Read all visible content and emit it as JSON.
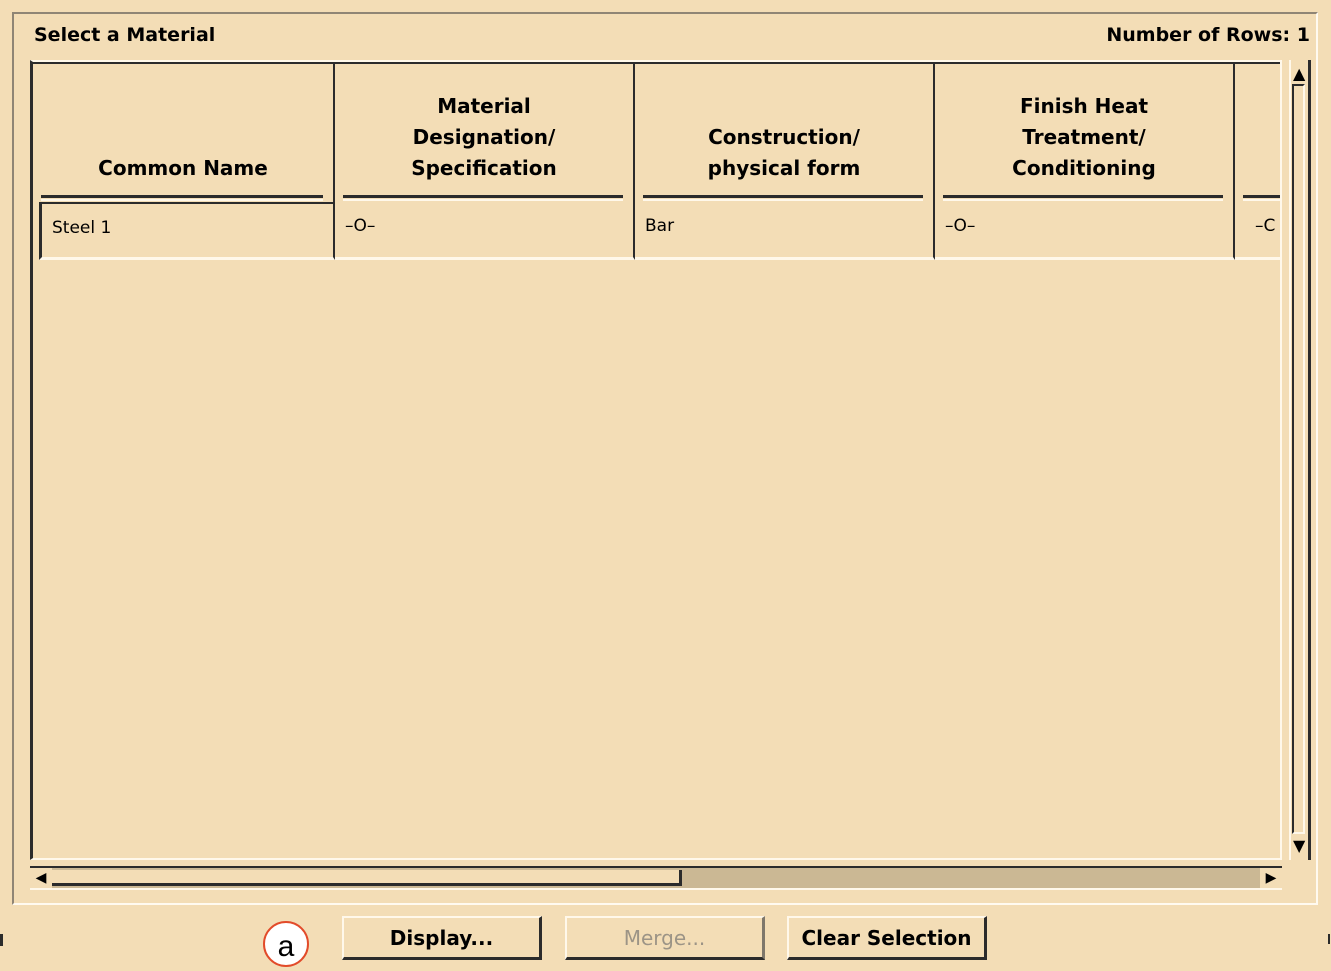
{
  "title": "Select a Material",
  "rows_label": "Number of Rows:",
  "rows_count": "1",
  "table": {
    "headers": [
      "Common Name",
      "Material\nDesignation/\nSpecification",
      "Construction/\nphysical form",
      "Finish Heat\nTreatment/\nConditioning",
      ""
    ],
    "rows": [
      [
        "Steel 1",
        "–O–",
        "Bar",
        "–O–",
        "–C"
      ]
    ]
  },
  "buttons": {
    "display": "Display...",
    "merge": "Merge...",
    "clear": "Clear Selection"
  },
  "callout": "a",
  "icons": {
    "scroll_up": "up-arrow-icon",
    "scroll_down": "down-arrow-icon",
    "scroll_left": "left-arrow-icon",
    "scroll_right": "right-arrow-icon"
  },
  "colors": {
    "background": "#f3ddb6",
    "callout_border": "#e24b2a"
  }
}
